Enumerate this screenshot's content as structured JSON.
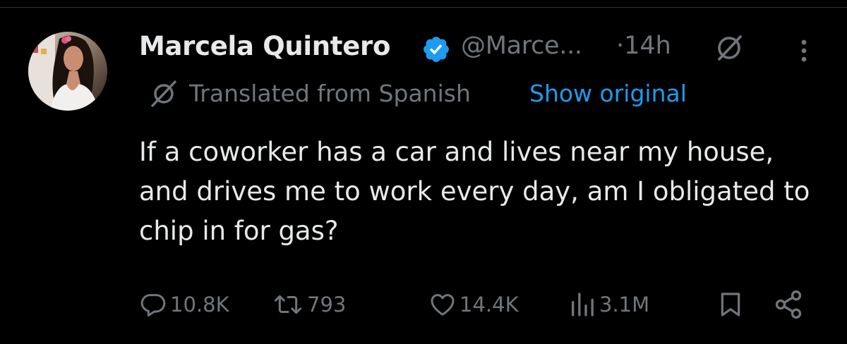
{
  "author": {
    "name": "Marcela Quintero",
    "handle": "@Marce...",
    "time_separator": "·",
    "time": "14h"
  },
  "translation": {
    "label": "Translated from Spanish",
    "show_original": "Show original"
  },
  "tweet": {
    "text": "If a coworker has a car and lives near my house, and drives me to work every day, am I obligated to chip in for gas?"
  },
  "metrics": {
    "replies": "10.8K",
    "reposts": "793",
    "likes": "14.4K",
    "views": "3.1M"
  },
  "colors": {
    "background": "#000000",
    "text_primary": "#e7e9ea",
    "text_secondary": "#71767b",
    "accent_link": "#1d9bf0",
    "verified_badge": "#1d9bf0"
  },
  "icons": [
    "verified-badge-icon",
    "grok-icon",
    "more-icon",
    "translate-icon",
    "reply-icon",
    "repost-icon",
    "like-icon",
    "views-icon",
    "bookmark-icon",
    "share-icon"
  ]
}
